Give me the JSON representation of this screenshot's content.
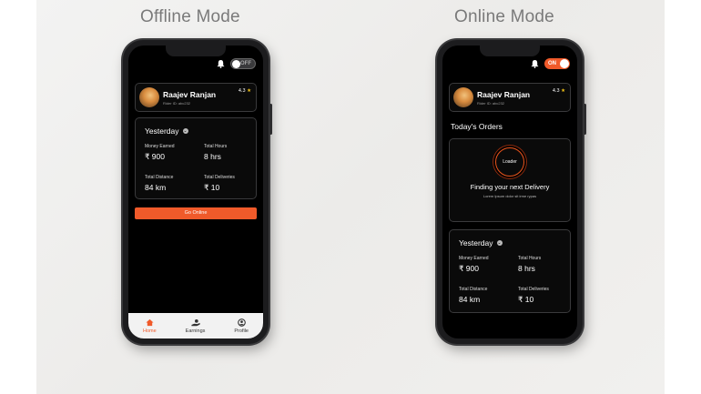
{
  "offline": {
    "mode_title": "Offline Mode",
    "toggle": "OFF",
    "profile": {
      "name": "Raajev Ranjan",
      "rider_id": "Rider ID: abc232",
      "rating": "4.3"
    },
    "stats": {
      "period": "Yesterday",
      "money_label": "Money Earned",
      "money_value": "₹ 900",
      "hours_label": "Total Hours",
      "hours_value": "8 hrs",
      "distance_label": "Total Distance",
      "distance_value": "84 km",
      "deliveries_label": "Total Deliveries",
      "deliveries_value": "₹ 10"
    },
    "cta": "Go Online",
    "nav": [
      {
        "label": "Home",
        "icon": "home-icon"
      },
      {
        "label": "Earnings",
        "icon": "earnings-icon"
      },
      {
        "label": "Profile",
        "icon": "profile-icon"
      }
    ]
  },
  "online": {
    "mode_title": "Online Mode",
    "toggle": "ON",
    "profile": {
      "name": "Raajev Ranjan",
      "rider_id": "Rider ID: abc232",
      "rating": "4.3"
    },
    "orders_title": "Today's Orders",
    "loader_label": "Loader",
    "finding_title": "Finding your next Delivery",
    "finding_sub": "Lorem Ipsum dolor sit irme rypas",
    "stats": {
      "period": "Yesterday",
      "money_label": "Money Earned",
      "money_value": "₹ 900",
      "hours_label": "Total Hours",
      "hours_value": "8 hrs",
      "distance_label": "Total Distance",
      "distance_value": "84 km",
      "deliveries_label": "Total Deliveries",
      "deliveries_value": "₹ 10"
    }
  },
  "colors": {
    "accent": "#f05a2a",
    "star": "#f5c518",
    "screen_bg": "#000000",
    "nav_bg": "#f2f2f2"
  }
}
